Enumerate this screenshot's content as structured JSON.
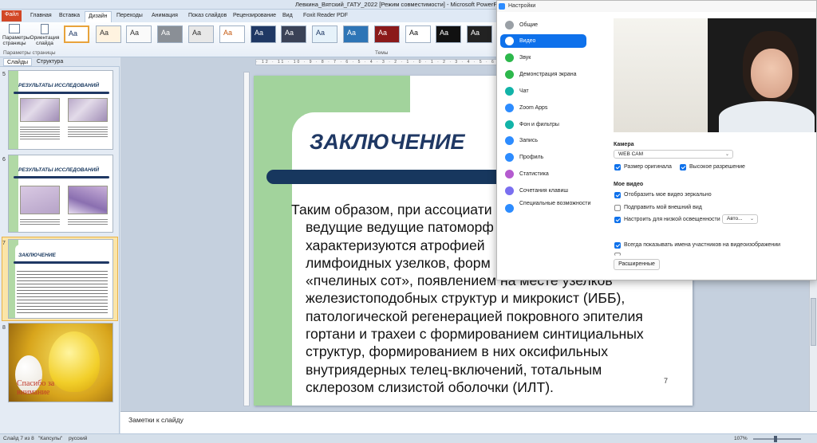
{
  "window": {
    "title": "Левкина_Вятский_ГАТУ_2022 [Режим совместимости] - Microsoft PowerPoint"
  },
  "ribbon": {
    "tabs": [
      "Файл",
      "Главная",
      "Вставка",
      "Дизайн",
      "Переходы",
      "Анимация",
      "Показ слайдов",
      "Рецензирование",
      "Вид",
      "Foxit Reader PDF"
    ],
    "page_setup_label": "Параметры страницы",
    "orientation_label": "Ориентация слайда",
    "group_page_setup": "Параметры страницы",
    "group_themes": "Темы",
    "theme_sample": "Aa"
  },
  "panel": {
    "tab_slides": "Слайды",
    "tab_structure": "Структура",
    "thumbs": [
      {
        "num": "5",
        "title": "РЕЗУЛЬТАТЫ ИССЛЕДОВАНИЙ"
      },
      {
        "num": "6",
        "title": "РЕЗУЛЬТАТЫ ИССЛЕДОВАНИЙ"
      },
      {
        "num": "7",
        "title": "ЗАКЛЮЧЕНИЕ"
      },
      {
        "num": "8",
        "caption": "Спасибо за внимание"
      }
    ]
  },
  "slide": {
    "title": "ЗАКЛЮЧЕНИЕ",
    "page_number": "7",
    "lines": [
      "Таким образом, при ассоциати",
      "ведущие ведущие патоморф",
      "характеризуются атрофией",
      "лимфоидных узелков, форм",
      "«пчелиных сот», появлением на месте узелков",
      "железистоподобных структур и микрокист (ИББ),",
      "патологической регенерацией покровного эпителия",
      "гортани и трахеи с формированием синтициальных",
      "структур, формированием в них оксифильных",
      "внутриядерных телец-включений, тотальным",
      "склерозом слизистой оболочки (ИЛТ)."
    ]
  },
  "notes": {
    "placeholder": "Заметки к слайду"
  },
  "status": {
    "slide": "Слайд 7 из 8",
    "theme": "\"Капсулы\"",
    "language": "русский",
    "zoom": "107%"
  },
  "settings": {
    "title": "Настройки",
    "menu": [
      "Общие",
      "Видео",
      "Звук",
      "Демонстрация экрана",
      "Чат",
      "Zoom Apps",
      "Фон и фильтры",
      "Запись",
      "Профиль",
      "Статистика",
      "Сочетания клавиш",
      "Специальные возможности"
    ],
    "menu_colors": [
      "#9aa0a6",
      "#0e71eb",
      "#2db84c",
      "#2db84c",
      "#12b3a8",
      "#2d8cff",
      "#12b3a8",
      "#2d8cff",
      "#2d8cff",
      "#b45bcf",
      "#7a6ff0",
      "#2d8cff"
    ],
    "camera_label": "Камера",
    "camera_value": "WEB CAM",
    "original_size": "Размер оригинала",
    "hd": "Высокое разрешение",
    "my_video_label": "Мое видео",
    "mirror": "Отобразить мое видео зеркально",
    "touch_up": "Подправить мой внешний вид",
    "low_light": "Настроить для низкой освещенности",
    "low_light_value": "Авто...",
    "show_names": "Всегда показывать имена участников на видеоизображении",
    "advanced": "Расширенные"
  }
}
